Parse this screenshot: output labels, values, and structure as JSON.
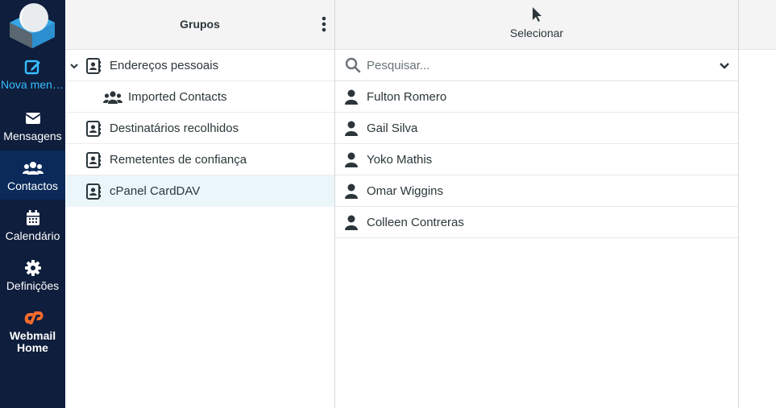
{
  "sidebar": {
    "items": [
      {
        "label": "Nova mens…",
        "icon": "compose-icon"
      },
      {
        "label": "Mensagens",
        "icon": "envelope-icon"
      },
      {
        "label": "Contactos",
        "icon": "users-icon"
      },
      {
        "label": "Calendário",
        "icon": "calendar-icon"
      },
      {
        "label": "Definições",
        "icon": "gear-icon"
      },
      {
        "label_line1": "Webmail",
        "label_line2": "Home",
        "icon": "cpanel-icon"
      }
    ],
    "colors": {
      "background": "#0f1e3c",
      "active": "#0b2a5a",
      "accent": "#37beff",
      "cpanel": "#ff6c2c"
    }
  },
  "groups": {
    "title": "Grupos",
    "items": [
      {
        "label": "Endereços pessoais",
        "icon": "address-book-icon",
        "expanded": true
      },
      {
        "label": "Imported Contacts",
        "icon": "group-icon"
      },
      {
        "label": "Destinatários recolhidos",
        "icon": "address-book-icon"
      },
      {
        "label": "Remetentes de confiança",
        "icon": "address-book-icon"
      },
      {
        "label": "cPanel CardDAV",
        "icon": "address-book-icon",
        "selected": true
      }
    ]
  },
  "contacts": {
    "select_label": "Selecionar",
    "search_placeholder": "Pesquisar...",
    "items": [
      {
        "name": "Fulton Romero"
      },
      {
        "name": "Gail Silva"
      },
      {
        "name": "Yoko Mathis"
      },
      {
        "name": "Omar Wiggins"
      },
      {
        "name": "Colleen Contreras"
      }
    ]
  }
}
